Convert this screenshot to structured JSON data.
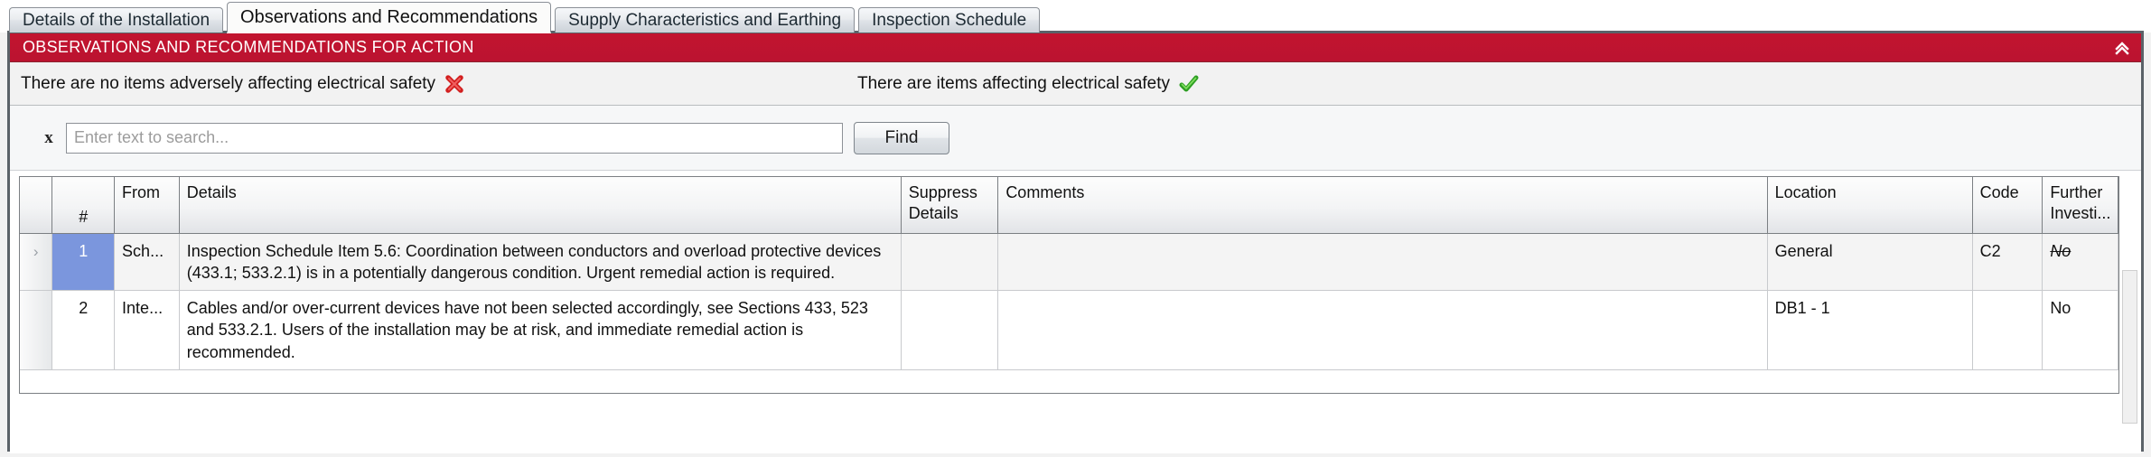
{
  "tabs": [
    {
      "label": "Details of the Installation",
      "active": false
    },
    {
      "label": "Observations and Recommendations",
      "active": true
    },
    {
      "label": "Supply Characteristics and Earthing",
      "active": false
    },
    {
      "label": "Inspection Schedule",
      "active": false
    }
  ],
  "panel": {
    "title": "OBSERVATIONS AND RECOMMENDATIONS FOR ACTION",
    "collapse_icon": "chevrons-up-icon",
    "header_color": "#c2142f"
  },
  "status": {
    "no_items_label": "There are no items adversely affecting electrical safety",
    "no_items_icon": "red-cross-icon",
    "items_label": "There are items affecting electrical safety",
    "items_icon": "green-tick-icon"
  },
  "search": {
    "clear_label": "x",
    "placeholder": "Enter text to search...",
    "value": "",
    "find_label": "Find"
  },
  "grid": {
    "columns": [
      {
        "key": "rowsel",
        "label": ""
      },
      {
        "key": "num",
        "label": "#"
      },
      {
        "key": "from",
        "label": "From"
      },
      {
        "key": "details",
        "label": "Details"
      },
      {
        "key": "suppress",
        "label": "Suppress Details"
      },
      {
        "key": "comments",
        "label": "Comments"
      },
      {
        "key": "location",
        "label": "Location"
      },
      {
        "key": "code",
        "label": "Code"
      },
      {
        "key": "further",
        "label": "Further Investi..."
      }
    ],
    "rows": [
      {
        "selected": true,
        "indicator": "›",
        "num": "1",
        "from": "Sch...",
        "details": "Inspection Schedule Item 5.6: Coordination between conductors and overload protective devices (433.1; 533.2.1) is in a potentially dangerous condition. Urgent remedial action is required.",
        "suppress": "",
        "comments": "",
        "location": "General",
        "code": "C2",
        "further": "No",
        "further_struck": true
      },
      {
        "selected": false,
        "indicator": "",
        "num": "2",
        "from": "Inte...",
        "details": "Cables and/or over-current devices have not been selected accordingly, see Sections 433, 523 and 533.2.1. Users of the installation may be at risk, and immediate remedial action is recommended.",
        "suppress": "",
        "comments": "",
        "location": "DB1 - 1",
        "code": "",
        "further": "No",
        "further_struck": false
      }
    ]
  }
}
